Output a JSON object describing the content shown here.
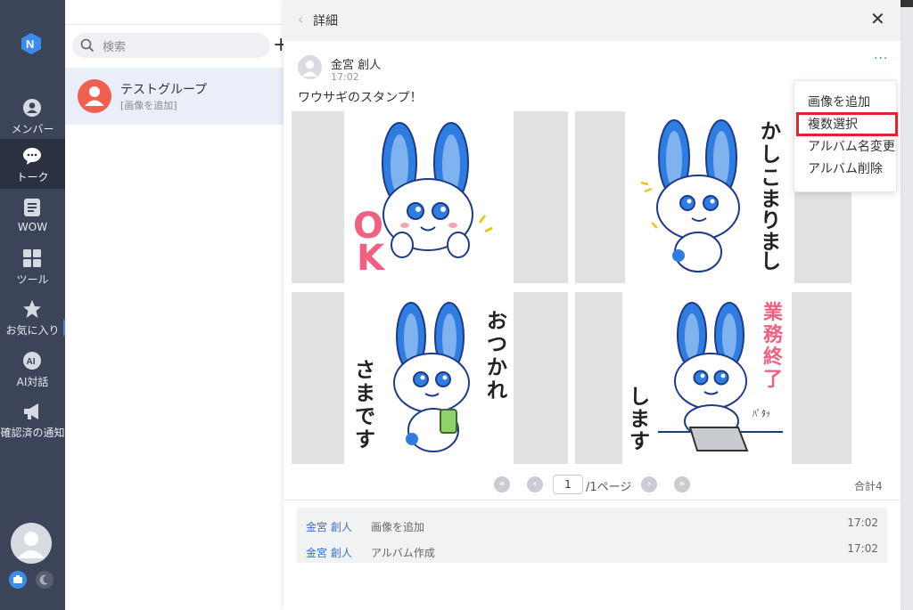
{
  "nav": {
    "items": [
      {
        "label": "メンバー",
        "icon": "member-icon"
      },
      {
        "label": "トーク",
        "icon": "chat-icon"
      },
      {
        "label": "WOW",
        "icon": "wow-icon"
      },
      {
        "label": "ツール",
        "icon": "tools-icon"
      },
      {
        "label": "お気に入り",
        "icon": "star-icon"
      },
      {
        "label": "AI対話",
        "icon": "ai-icon"
      },
      {
        "label": "確認済の通知",
        "icon": "megaphone-icon"
      }
    ],
    "active_index": 1
  },
  "search": {
    "placeholder": "検索"
  },
  "conversation": {
    "name": "テストグループ",
    "last_message": "[画像を追加]"
  },
  "panel": {
    "title": "詳細",
    "post": {
      "author": "金宮 創人",
      "time": "17:02",
      "more_label": "···",
      "message": "ワウサギのスタンプ！",
      "images": [
        {
          "text": "OK"
        },
        {
          "text": "かしこまりました"
        },
        {
          "text": "おつかれさまです"
        },
        {
          "text": "業務終了します"
        }
      ]
    },
    "pager": {
      "current": "1",
      "total": "/1ページ",
      "count": "合計4"
    },
    "history": [
      {
        "name": "金宮 創人",
        "action": "画像を追加",
        "time": "17:02"
      },
      {
        "name": "金宮 創人",
        "action": "アルバム作成",
        "time": "17:02"
      }
    ]
  },
  "menu": {
    "items": [
      "画像を追加",
      "複数選択",
      "アルバム名変更",
      "アルバム削除"
    ],
    "highlighted_index": 1,
    "highlight_color": "#e3232d"
  },
  "colors": {
    "nav_bg": "#3b4458",
    "accent": "#3b7ff0",
    "rabbit_blue": "#2f7de0",
    "text_pink": "#f06080"
  }
}
